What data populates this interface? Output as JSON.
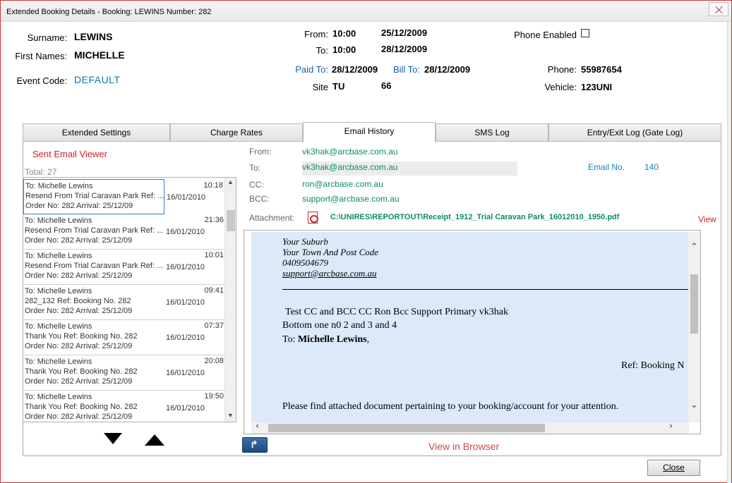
{
  "window": {
    "title": "Extended Booking Details - Booking: LEWINS Number: 282"
  },
  "booking": {
    "surname_label": "Surname:",
    "surname": "LEWINS",
    "first_names_label": "First Names:",
    "first_names": "MICHELLE",
    "event_code_label": "Event Code:",
    "event_code": "DEFAULT",
    "from_label": "From:",
    "from_time": "10:00",
    "from_date": "25/12/2009",
    "to_label": "To:",
    "to_time": "10:00",
    "to_date": "28/12/2009",
    "paid_to_label": "Paid To:",
    "paid_to": "28/12/2009",
    "bill_to_label": "Bill To:",
    "bill_to": "28/12/2009",
    "site_label": "Site",
    "site": "TU",
    "site_number": "66",
    "phone_enabled_label": "Phone Enabled",
    "phone_enabled": false,
    "phone_label": "Phone:",
    "phone": "55987654",
    "vehicle_label": "Vehicle:",
    "vehicle": "123UNI"
  },
  "tabs": [
    {
      "label": "Extended Settings",
      "active": false
    },
    {
      "label": "Charge Rates",
      "active": false
    },
    {
      "label": "Email  History",
      "active": true
    },
    {
      "label": "SMS Log",
      "active": false
    },
    {
      "label": "Entry/Exit Log (Gate Log)",
      "active": false
    }
  ],
  "viewer": {
    "title": "Sent Email Viewer",
    "total": "Total:  27",
    "items": [
      {
        "to": "To: Michelle Lewins",
        "subject": "Resend From Trial Caravan Park Ref: ...",
        "order": "Order No: 282 Arrival: 25/12/09",
        "date": "16/01/2010",
        "time": "10:18"
      },
      {
        "to": "To: Michelle Lewins",
        "subject": "Resend From Trial Caravan Park Ref: ...",
        "order": "Order No: 282 Arrival: 25/12/09",
        "date": "16/01/2010",
        "time": "21:36"
      },
      {
        "to": "To: Michelle Lewins",
        "subject": "Resend From Trial Caravan Park Ref: ...",
        "order": "Order No: 282 Arrival: 25/12/09",
        "date": "16/01/2010",
        "time": "10:01"
      },
      {
        "to": "To: Michelle Lewins",
        "subject": "282_132 Ref: Booking No. 282",
        "order": "Order No: 282 Arrival: 25/12/09",
        "date": "16/01/2010",
        "time": "09:41"
      },
      {
        "to": "To: Michelle Lewins",
        "subject": "Thank You Ref: Booking No. 282",
        "order": "Order No: 282 Arrival: 25/12/09",
        "date": "16/01/2010",
        "time": "07:37"
      },
      {
        "to": "To: Michelle Lewins",
        "subject": "Thank You Ref: Booking No. 282",
        "order": "Order No: 282 Arrival: 25/12/09",
        "date": "16/01/2010",
        "time": "20:08"
      },
      {
        "to": "To: Michelle Lewins",
        "subject": "Thank You Ref: Booking No. 282",
        "order": "Order No: 282 Arrival: 25/12/09",
        "date": "16/01/2010",
        "time": "19:50"
      }
    ]
  },
  "email": {
    "from_label": "From:",
    "from": "vk3hak@arcbase.com.au",
    "to_label": "To:",
    "to": "vk3hak@arcbase.com.au",
    "cc_label": "CC:",
    "cc": "ron@arcbase.com.au",
    "bcc_label": "BCC:",
    "bcc": "support@arcbase.com.au",
    "email_no_label": "Email No.",
    "email_no": "140",
    "attachment_label": "Attachment:",
    "attachment_path": "C:\\UNIRES\\REPORTOUT\\Receipt_1912_Trial Caravan Park_16012010_1950.pdf",
    "view_label": "View",
    "body": {
      "suburb": "Your Suburb",
      "town": "Your Town And Post Code",
      "phone": "0409504679",
      "email": "support@arcbase.com.au",
      "line1": "Test CC and BCC CC Ron Bcc Support Primary vk3hak",
      "line2": "Bottom one n0 2 and 3 and 4",
      "to_prefix": "To: ",
      "to_name": "Michelle Lewins",
      "to_suffix": ",",
      "ref": "Ref: Booking N",
      "para": "Please find attached document pertaining to your booking/account for your attention."
    },
    "view_in_browser": "View in Browser"
  },
  "footer": {
    "close_label": "Close"
  },
  "colors": {
    "accent_red": "#d02020",
    "teal": "#0c8a6a",
    "link_blue": "#1a5fa8",
    "body_bg": "#dce9f8"
  }
}
